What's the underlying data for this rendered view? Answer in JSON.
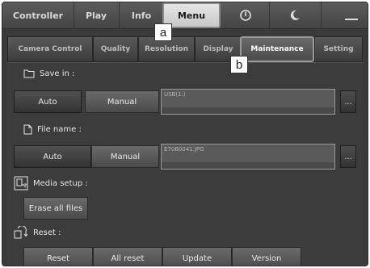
{
  "topbar": {
    "tabs": [
      "Controller",
      "Play",
      "Info",
      "Menu"
    ],
    "power_icon": "power-icon",
    "moon_icon": "moon-icon"
  },
  "menu_tabs": [
    "Camera Control",
    "Quality",
    "Resolution",
    "Display",
    "Maintenance",
    "Setting"
  ],
  "save_in": {
    "label": "Save in :",
    "auto": "Auto",
    "manual": "Manual",
    "path": "USB(1:)",
    "browse": "..."
  },
  "file_name": {
    "label": "File name :",
    "auto": "Auto",
    "manual": "Manual",
    "value": "E7060041.JPG",
    "browse": "..."
  },
  "media_setup": {
    "label": "Media setup :",
    "erase": "Erase all files"
  },
  "reset": {
    "label": "Reset :",
    "buttons": [
      "Reset",
      "All reset",
      "Update",
      "Version"
    ]
  },
  "callouts": [
    "a",
    "b"
  ],
  "colors": {
    "active_tab": "#d6d6d6",
    "panel": "#3c3c3c"
  }
}
